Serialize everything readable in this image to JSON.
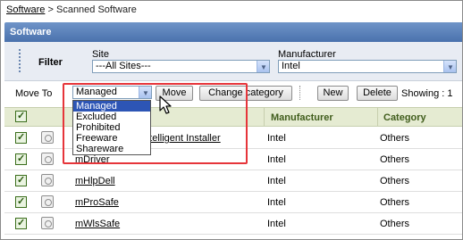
{
  "breadcrumb": {
    "root": "Software",
    "separator": ">",
    "current": "Scanned Software"
  },
  "panel": {
    "title": "Software"
  },
  "filter": {
    "label": "Filter",
    "site": {
      "label": "Site",
      "value": "---All Sites---"
    },
    "manufacturer": {
      "label": "Manufacturer",
      "value": "Intel"
    }
  },
  "toolbar": {
    "move_to_label": "Move To",
    "move_to_value": "Managed",
    "move_button": "Move",
    "change_category_button": "Change category",
    "new_button": "New",
    "delete_button": "Delete",
    "showing_text": "Showing : 1"
  },
  "dropdown": {
    "options": [
      "Managed",
      "Excluded",
      "Prohibited",
      "Freeware",
      "Shareware"
    ],
    "selected": "Managed"
  },
  "table": {
    "columns": {
      "manufacturer": "Manufacturer",
      "category": "Category"
    },
    "rows": [
      {
        "name": "Intelligent Installer",
        "manufacturer": "Intel",
        "category": "Others",
        "checked": true
      },
      {
        "name": "mDriver",
        "manufacturer": "Intel",
        "category": "Others",
        "checked": true
      },
      {
        "name": "mHlpDell",
        "manufacturer": "Intel",
        "category": "Others",
        "checked": true
      },
      {
        "name": "mProSafe",
        "manufacturer": "Intel",
        "category": "Others",
        "checked": true
      },
      {
        "name": "mWlsSafe",
        "manufacturer": "Intel",
        "category": "Others",
        "checked": true
      }
    ]
  },
  "colors": {
    "header": "#4a72ad",
    "table_header": "#e5ebd2",
    "selection": "#2d55b5",
    "highlight": "#e6353a"
  }
}
